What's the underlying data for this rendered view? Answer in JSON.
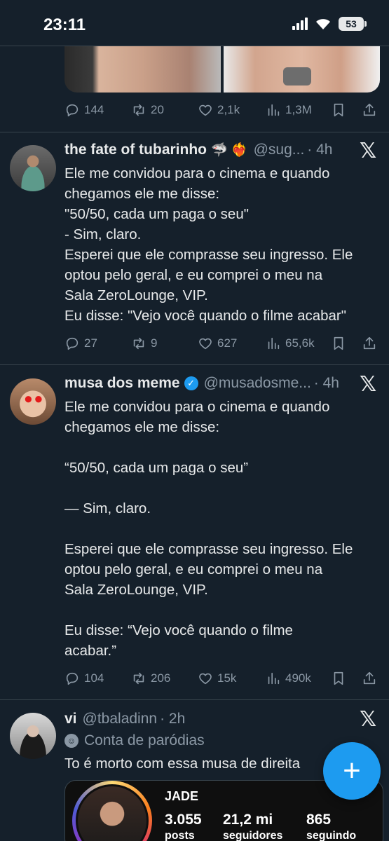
{
  "status_bar": {
    "time": "23:11",
    "battery": "53"
  },
  "tweets": [
    {
      "actions": {
        "replies": "144",
        "retweets": "20",
        "likes": "2,1k",
        "views": "1,3M"
      }
    },
    {
      "display_name": "the fate of tubarinho",
      "emojis": "🦈 ❤️‍🔥",
      "handle": "@sug...",
      "time": "· 4h",
      "lines": [
        "Ele me convidou para o cinema e quando",
        "chegamos ele me disse:",
        "\"50/50, cada um paga o seu\"",
        "- Sim, claro.",
        "Esperei que ele comprasse seu ingresso. Ele",
        "optou pelo geral, e eu comprei o meu na",
        "Sala ZeroLounge, VIP.",
        "Eu disse: \"Vejo você quando o filme acabar\""
      ],
      "actions": {
        "replies": "27",
        "retweets": "9",
        "likes": "627",
        "views": "65,6k"
      }
    },
    {
      "display_name": "musa dos meme",
      "handle": "@musadosme...",
      "time": "· 4h",
      "lines": [
        "Ele me convidou para o cinema e quando",
        "chegamos ele me disse:",
        "",
        "“50/50, cada um paga o seu”",
        "",
        "— Sim, claro.",
        "",
        "Esperei que ele comprasse seu ingresso. Ele",
        "optou pelo geral, e eu comprei o meu na",
        "Sala ZeroLounge, VIP.",
        "",
        "Eu disse: “Vejo você quando o filme",
        "acabar.”"
      ],
      "actions": {
        "replies": "104",
        "retweets": "206",
        "likes": "15k",
        "views": "490k"
      }
    },
    {
      "display_name": "vi",
      "handle": "@tbaladinn",
      "time": "· 2h",
      "label": "Conta de paródias",
      "text": "To é morto com essa musa de direita",
      "quote": {
        "name": "JADE",
        "posts_num": "3.055",
        "posts_label": "posts",
        "followers_num": "21,2 mi",
        "followers_label": "seguidores",
        "following_num": "865",
        "following_label": "seguindo"
      }
    }
  ],
  "fab_label": "+",
  "x_logo": "𝕏"
}
